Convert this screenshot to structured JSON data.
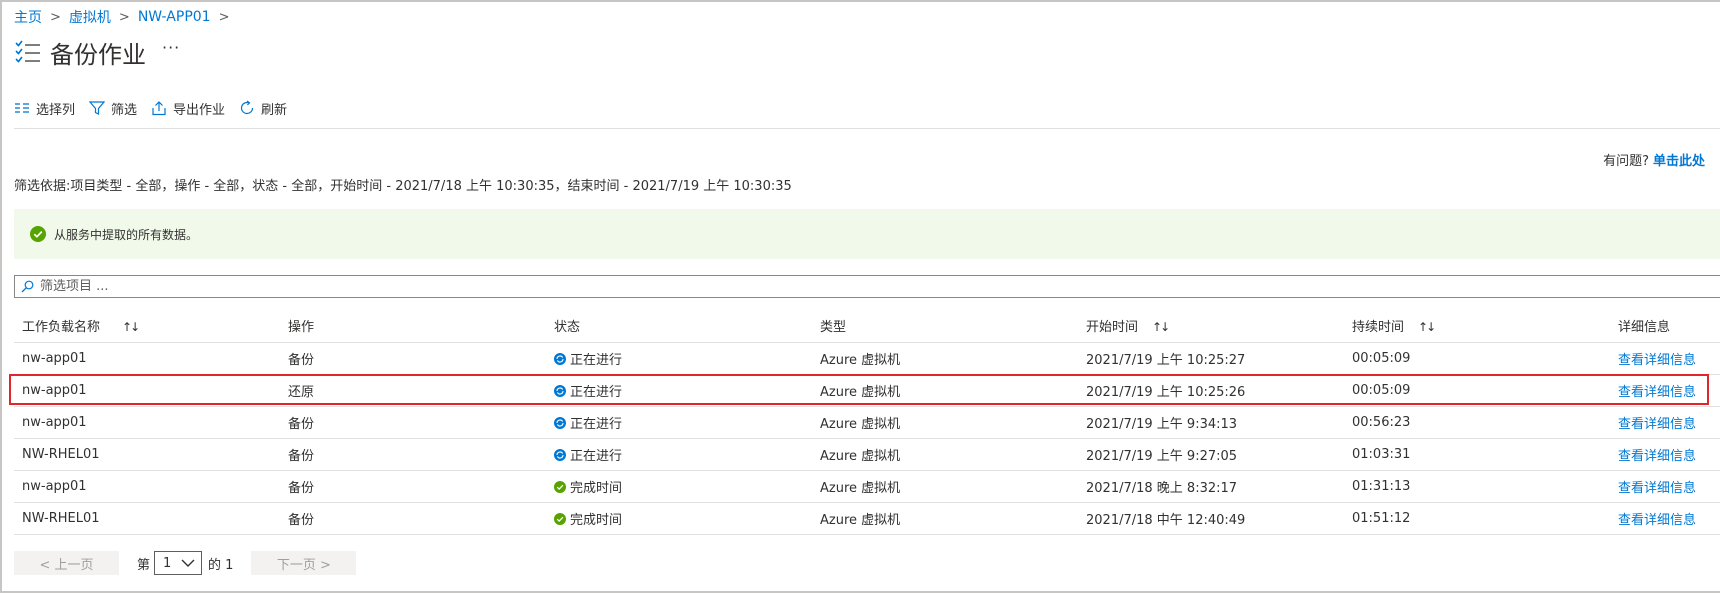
{
  "breadcrumb": {
    "items": [
      "主页",
      "虚拟机",
      "NW-APP01"
    ],
    "separator": ">"
  },
  "header": {
    "title": "备份作业",
    "more": "···"
  },
  "toolbar": {
    "columns_label": "选择列",
    "filter_label": "筛选",
    "export_label": "导出作业",
    "refresh_label": "刷新"
  },
  "help": {
    "prefix": "有问题?",
    "link": "单击此处"
  },
  "filter_description": "筛选依据:项目类型 - 全部，操作 - 全部，状态 - 全部，开始时间 - 2021/7/18 上午 10:30:35，结束时间 - 2021/7/19 上午 10:30:35",
  "banner": {
    "message": "从服务中提取的所有数据。"
  },
  "search": {
    "placeholder": "筛选项目 ..."
  },
  "table": {
    "headers": [
      "工作负载名称",
      "操作",
      "状态",
      "类型",
      "开始时间",
      "持续时间",
      "详细信息"
    ],
    "sort_glyph": "↑↓",
    "rows": [
      {
        "name": "nw-app01",
        "operation": "备份",
        "status": "正在进行",
        "status_kind": "in-progress",
        "type": "Azure 虚拟机",
        "start": "2021/7/19 上午 10:25:27",
        "duration": "00:05:09",
        "details": "查看详细信息"
      },
      {
        "name": "nw-app01",
        "operation": "还原",
        "status": "正在进行",
        "status_kind": "in-progress",
        "type": "Azure 虚拟机",
        "start": "2021/7/19 上午 10:25:26",
        "duration": "00:05:09",
        "details": "查看详细信息"
      },
      {
        "name": "nw-app01",
        "operation": "备份",
        "status": "正在进行",
        "status_kind": "in-progress",
        "type": "Azure 虚拟机",
        "start": "2021/7/19 上午 9:34:13",
        "duration": "00:56:23",
        "details": "查看详细信息"
      },
      {
        "name": "NW-RHEL01",
        "operation": "备份",
        "status": "正在进行",
        "status_kind": "in-progress",
        "type": "Azure 虚拟机",
        "start": "2021/7/19 上午 9:27:05",
        "duration": "01:03:31",
        "details": "查看详细信息"
      },
      {
        "name": "nw-app01",
        "operation": "备份",
        "status": "完成时间",
        "status_kind": "completed",
        "type": "Azure 虚拟机",
        "start": "2021/7/18 晚上 8:32:17",
        "duration": "01:31:13",
        "details": "查看详细信息"
      },
      {
        "name": "NW-RHEL01",
        "operation": "备份",
        "status": "完成时间",
        "status_kind": "completed",
        "type": "Azure 虚拟机",
        "start": "2021/7/18 中午 12:40:49",
        "duration": "01:51:12",
        "details": "查看详细信息"
      }
    ]
  },
  "pager": {
    "prev_label": "< 上一页",
    "page_prefix": "第",
    "current_page": "1",
    "page_suffix": "的 1",
    "next_label": "下一页 >"
  },
  "colors": {
    "accent": "#0078d4",
    "success": "#57a300",
    "highlight": "#e0262b",
    "banner_bg": "#f1faea"
  }
}
